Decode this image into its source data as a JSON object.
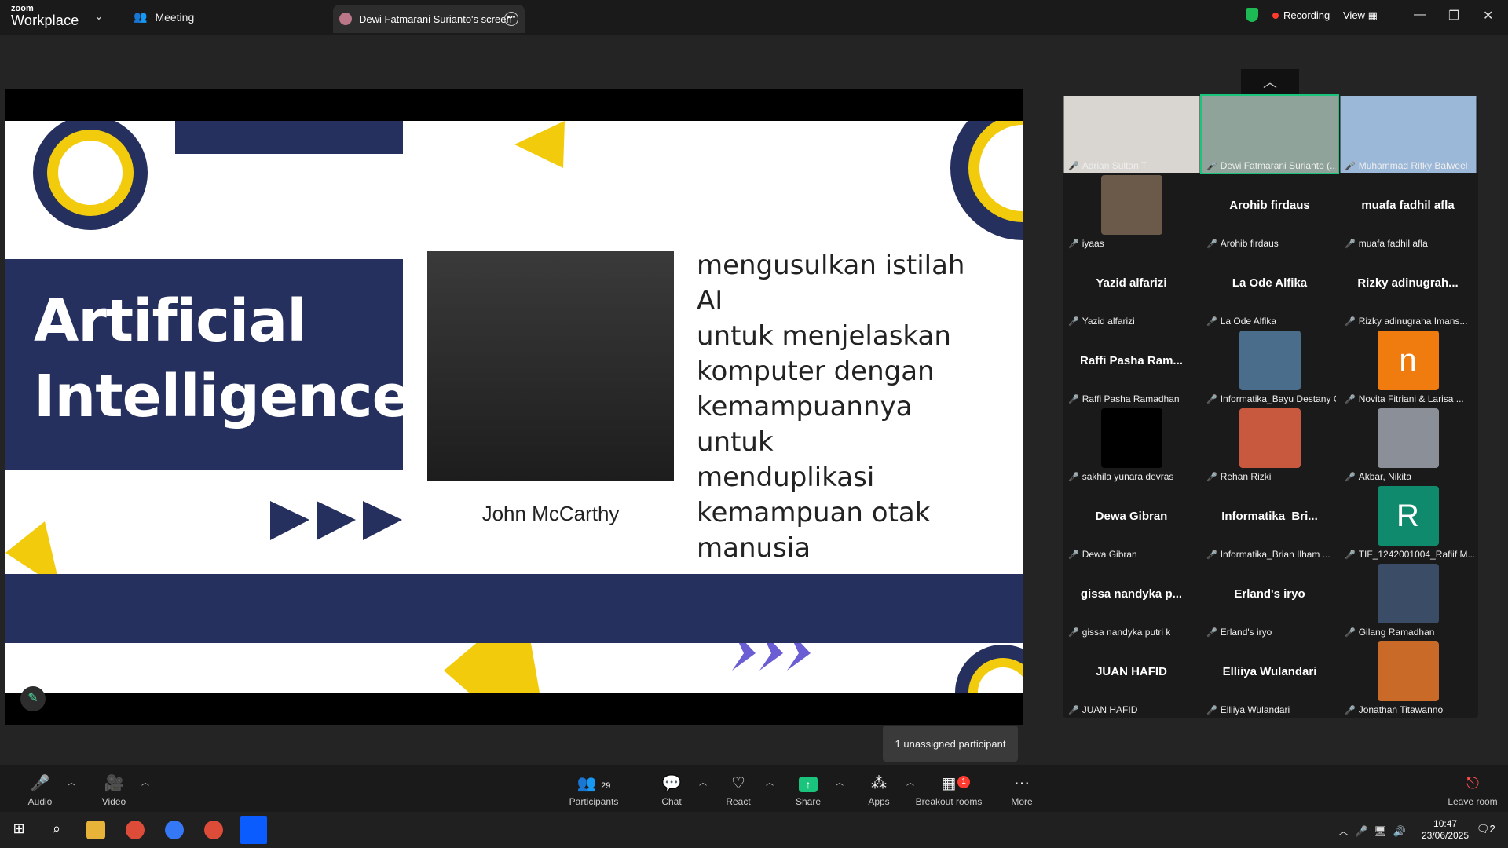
{
  "app": {
    "brand_top": "zoom",
    "brand_bottom": "Workplace"
  },
  "topbar": {
    "meeting_label": "Meeting",
    "share_tab_label": "Dewi Fatmarani Surianto's screen",
    "recording_label": "Recording",
    "view_label": "View"
  },
  "slide": {
    "title_line1": "Artificial",
    "title_line2": "Intelligence",
    "caption": "John McCarthy",
    "quote_lines": [
      "mengusulkan istilah AI",
      "untuk menjelaskan",
      "komputer dengan",
      "kemampuannya untuk",
      "menduplikasi",
      "kemampuan otak",
      "manusia"
    ]
  },
  "participants": [
    {
      "display": "",
      "label": "Adrian Sultan T",
      "thumb": "video",
      "color": "#d9d6d2"
    },
    {
      "display": "",
      "label": "Dewi Fatmarani Surianto (...",
      "thumb": "video",
      "color": "#8fa39a",
      "active": true
    },
    {
      "display": "",
      "label": "Muhammad Rifky Balweel",
      "thumb": "video",
      "color": "#9cb8d8"
    },
    {
      "display": "",
      "label": "iyaas",
      "thumb": "image",
      "color": "#6b5a4a"
    },
    {
      "display": "Arohib firdaus",
      "label": "Arohib firdaus"
    },
    {
      "display": "muafa fadhil afla",
      "label": "muafa fadhil afla"
    },
    {
      "display": "Yazid alfarizi",
      "label": "Yazid alfarizi"
    },
    {
      "display": "La Ode Alfika",
      "label": "La Ode Alfika"
    },
    {
      "display": "Rizky  adinugrah...",
      "label": "Rizky adinugraha Imans..."
    },
    {
      "display": "Raffi Pasha Ram...",
      "label": "Raffi Pasha Ramadhan"
    },
    {
      "display": "",
      "label": "Informatika_Bayu Destany G...",
      "thumb": "image",
      "color": "#4a6d8c"
    },
    {
      "display": "",
      "label": "Novita Fitriani & Larisa ...",
      "thumb": "letter",
      "letter": "n",
      "color": "#f07b0e"
    },
    {
      "display": "",
      "label": "sakhila yunara devras",
      "thumb": "image",
      "color": "#000000"
    },
    {
      "display": "",
      "label": "Rehan Rizki",
      "thumb": "image",
      "color": "#c9593e"
    },
    {
      "display": "",
      "label": "Akbar, Nikita",
      "thumb": "image",
      "color": "#8a8f98"
    },
    {
      "display": "Dewa Gibran",
      "label": "Dewa Gibran"
    },
    {
      "display": "Informatika_Bri...",
      "label": "Informatika_Brian Ilham ..."
    },
    {
      "display": "",
      "label": "TIF_1242001004_Rafiif M...",
      "thumb": "letter",
      "letter": "R",
      "color": "#0f8a6d"
    },
    {
      "display": "gissa  nandyka  p...",
      "label": "gissa nandyka putri k"
    },
    {
      "display": "Erland's iryo",
      "label": "Erland's iryo"
    },
    {
      "display": "",
      "label": "Gilang Ramadhan",
      "thumb": "image",
      "color": "#3b4d66"
    },
    {
      "display": "JUAN HAFID",
      "label": "JUAN HAFID"
    },
    {
      "display": "Elliiya Wulandari",
      "label": "Elliiya Wulandari"
    },
    {
      "display": "",
      "label": "Jonathan Titawanno",
      "thumb": "image",
      "color": "#c96a28"
    }
  ],
  "tooltip": "1 unassigned participant",
  "toolbar": {
    "audio": "Audio",
    "video": "Video",
    "participants": "Participants",
    "participants_count": "29",
    "chat": "Chat",
    "react": "React",
    "share": "Share",
    "apps": "Apps",
    "breakout": "Breakout rooms",
    "breakout_badge": "1",
    "more": "More",
    "leave": "Leave room"
  },
  "taskbar": {
    "time": "10:47",
    "date": "23/06/2025",
    "notif": "2"
  },
  "colors": {
    "slide_navy": "#26305e",
    "slide_yellow": "#f2cc0c",
    "zoom_green": "#1bc47d",
    "muted_red": "#ff4d4f"
  }
}
